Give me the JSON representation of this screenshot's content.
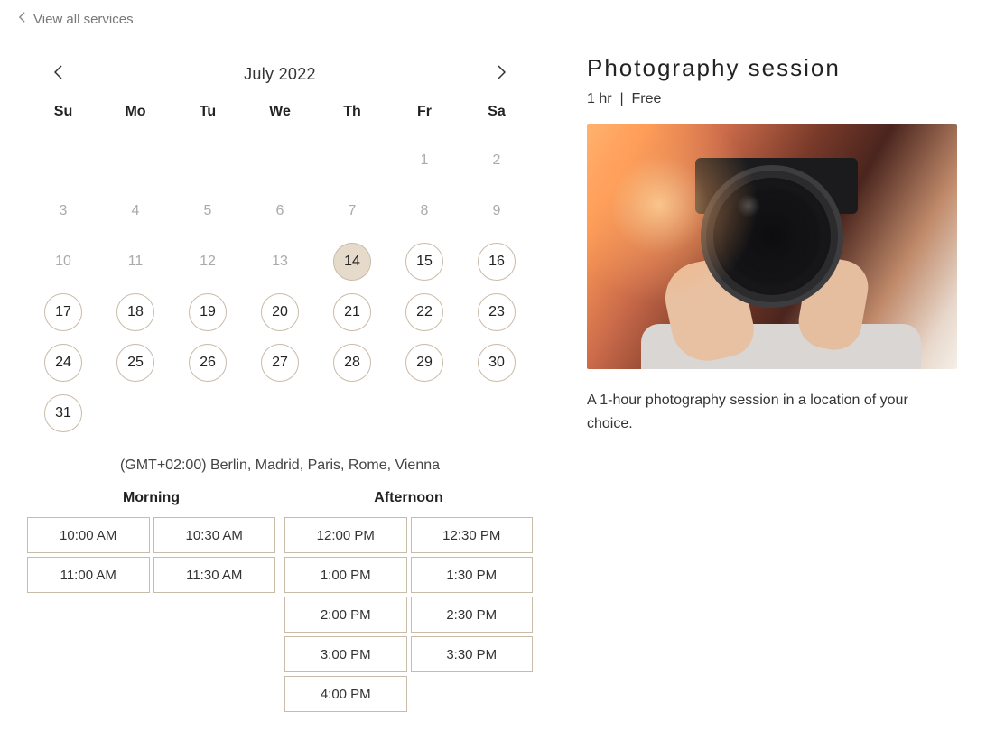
{
  "back_link": "View all services",
  "calendar": {
    "month_label": "July 2022",
    "dow": [
      "Su",
      "Mo",
      "Tu",
      "We",
      "Th",
      "Fr",
      "Sa"
    ],
    "leading_blanks": 5,
    "days": [
      {
        "n": "1",
        "state": "disabled"
      },
      {
        "n": "2",
        "state": "disabled"
      },
      {
        "n": "3",
        "state": "disabled"
      },
      {
        "n": "4",
        "state": "disabled"
      },
      {
        "n": "5",
        "state": "disabled"
      },
      {
        "n": "6",
        "state": "disabled"
      },
      {
        "n": "7",
        "state": "disabled"
      },
      {
        "n": "8",
        "state": "disabled"
      },
      {
        "n": "9",
        "state": "disabled"
      },
      {
        "n": "10",
        "state": "disabled"
      },
      {
        "n": "11",
        "state": "disabled"
      },
      {
        "n": "12",
        "state": "disabled"
      },
      {
        "n": "13",
        "state": "disabled"
      },
      {
        "n": "14",
        "state": "selected"
      },
      {
        "n": "15",
        "state": "available"
      },
      {
        "n": "16",
        "state": "available"
      },
      {
        "n": "17",
        "state": "available"
      },
      {
        "n": "18",
        "state": "available"
      },
      {
        "n": "19",
        "state": "available"
      },
      {
        "n": "20",
        "state": "available"
      },
      {
        "n": "21",
        "state": "available"
      },
      {
        "n": "22",
        "state": "available"
      },
      {
        "n": "23",
        "state": "available"
      },
      {
        "n": "24",
        "state": "available"
      },
      {
        "n": "25",
        "state": "available"
      },
      {
        "n": "26",
        "state": "available"
      },
      {
        "n": "27",
        "state": "available"
      },
      {
        "n": "28",
        "state": "available"
      },
      {
        "n": "29",
        "state": "available"
      },
      {
        "n": "30",
        "state": "available"
      },
      {
        "n": "31",
        "state": "available"
      }
    ]
  },
  "timezone": "(GMT+02:00) Berlin, Madrid, Paris, Rome, Vienna",
  "slots": {
    "morning": {
      "title": "Morning",
      "times": [
        "10:00 AM",
        "10:30 AM",
        "11:00 AM",
        "11:30 AM"
      ]
    },
    "afternoon": {
      "title": "Afternoon",
      "times": [
        "12:00 PM",
        "12:30 PM",
        "1:00 PM",
        "1:30 PM",
        "2:00 PM",
        "2:30 PM",
        "3:00 PM",
        "3:30 PM",
        "4:00 PM"
      ]
    }
  },
  "service": {
    "title": "Photography session",
    "duration": "1 hr",
    "separator": "|",
    "price": "Free",
    "description": "A 1-hour photography session in a location of your choice."
  }
}
